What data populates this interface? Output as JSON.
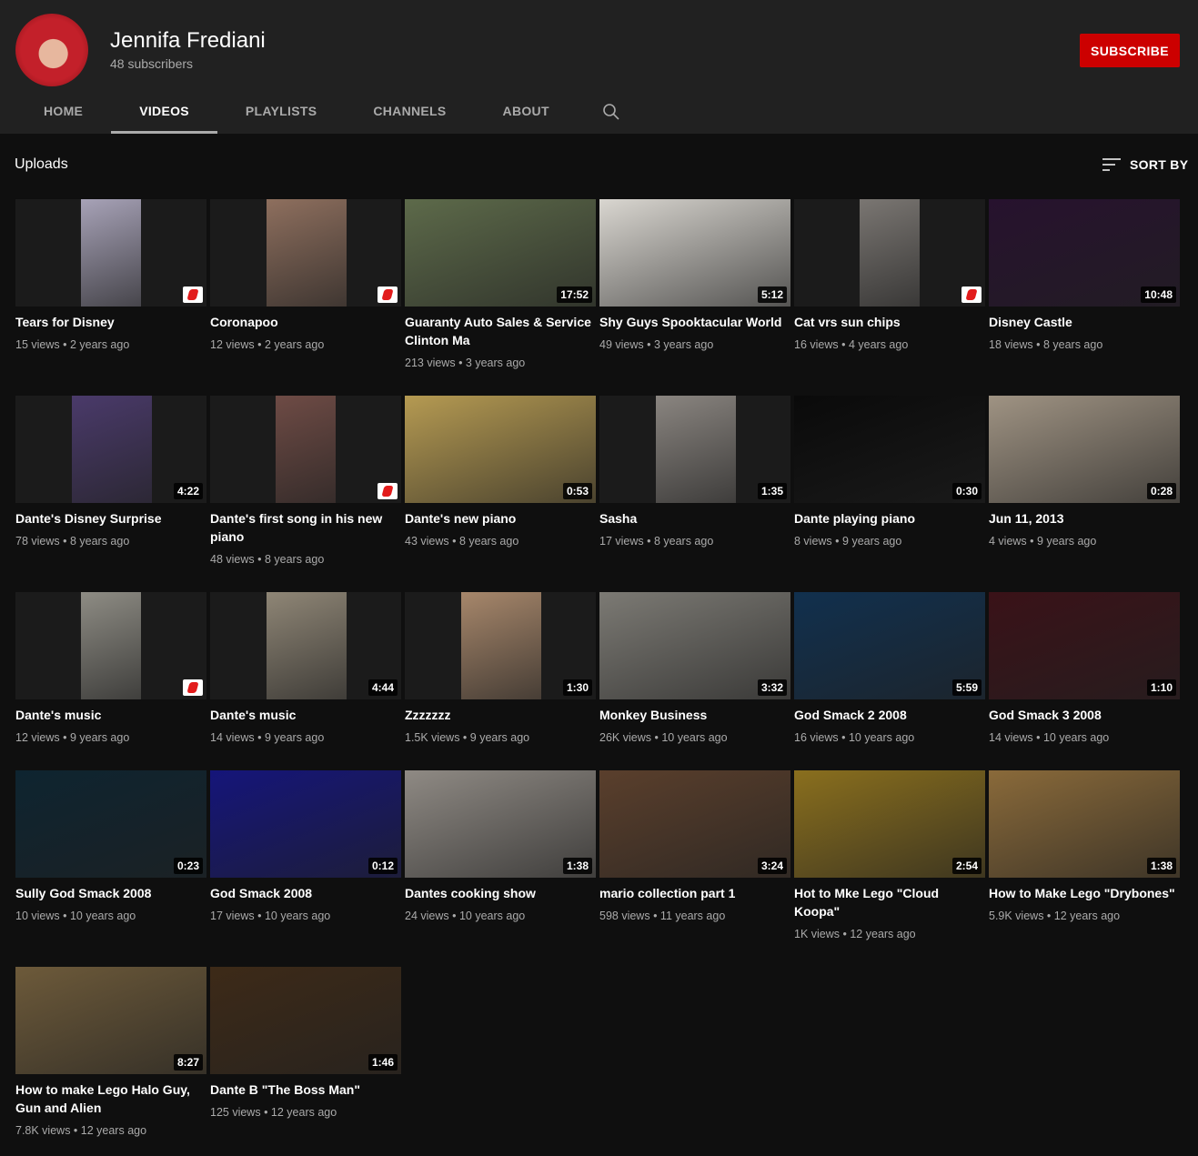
{
  "channel": {
    "name": "Jennifa Frediani",
    "subscribers": "48 subscribers",
    "subscribe_label": "SUBSCRIBE"
  },
  "tabs": [
    {
      "label": "HOME",
      "active": false
    },
    {
      "label": "VIDEOS",
      "active": true
    },
    {
      "label": "PLAYLISTS",
      "active": false
    },
    {
      "label": "CHANNELS",
      "active": false
    },
    {
      "label": "ABOUT",
      "active": false
    }
  ],
  "section": {
    "title": "Uploads",
    "sort_label": "SORT BY"
  },
  "videos": [
    {
      "title": "Tears for Disney",
      "views": "15 views",
      "age": "2 years ago",
      "duration": "",
      "shorts": true,
      "color": "#a7a2b7"
    },
    {
      "title": "Coronapoo",
      "views": "12 views",
      "age": "2 years ago",
      "duration": "",
      "shorts": true,
      "color": "#8e6f5e"
    },
    {
      "title": "Guaranty Auto Sales & Service Clinton Ma",
      "views": "213 views",
      "age": "3 years ago",
      "duration": "17:52",
      "shorts": false,
      "color": "#5d6a4a"
    },
    {
      "title": "Shy Guys Spooktacular World",
      "views": "49 views",
      "age": "3 years ago",
      "duration": "5:12",
      "shorts": false,
      "color": "#d9d6d0"
    },
    {
      "title": "Cat vrs sun chips",
      "views": "16 views",
      "age": "4 years ago",
      "duration": "",
      "shorts": true,
      "color": "#7a7672"
    },
    {
      "title": "Disney Castle",
      "views": "18 views",
      "age": "8 years ago",
      "duration": "10:48",
      "shorts": false,
      "color": "#27122e"
    },
    {
      "title": "Dante's Disney Surprise",
      "views": "78 views",
      "age": "8 years ago",
      "duration": "4:22",
      "shorts": false,
      "color": "#4a3a6a"
    },
    {
      "title": "Dante's first song in his new piano",
      "views": "48 views",
      "age": "8 years ago",
      "duration": "",
      "shorts": true,
      "color": "#6e4b45"
    },
    {
      "title": "Dante's new piano",
      "views": "43 views",
      "age": "8 years ago",
      "duration": "0:53",
      "shorts": false,
      "color": "#b59a52"
    },
    {
      "title": "Sasha",
      "views": "17 views",
      "age": "8 years ago",
      "duration": "1:35",
      "shorts": false,
      "color": "#8a8580"
    },
    {
      "title": "Dante playing piano",
      "views": "8 views",
      "age": "9 years ago",
      "duration": "0:30",
      "shorts": false,
      "color": "#0a0a0a"
    },
    {
      "title": "Jun 11, 2013",
      "views": "4 views",
      "age": "9 years ago",
      "duration": "0:28",
      "shorts": false,
      "color": "#9f9383"
    },
    {
      "title": "Dante's music",
      "views": "12 views",
      "age": "9 years ago",
      "duration": "",
      "shorts": true,
      "color": "#8e8c84"
    },
    {
      "title": "Dante's music",
      "views": "14 views",
      "age": "9 years ago",
      "duration": "4:44",
      "shorts": false,
      "color": "#8f8676"
    },
    {
      "title": "Zzzzzzz",
      "views": "1.5K views",
      "age": "9 years ago",
      "duration": "1:30",
      "shorts": false,
      "color": "#a7876b"
    },
    {
      "title": "Monkey Business",
      "views": "26K views",
      "age": "10 years ago",
      "duration": "3:32",
      "shorts": false,
      "color": "#7c7a74"
    },
    {
      "title": "God Smack 2 2008",
      "views": "16 views",
      "age": "10 years ago",
      "duration": "5:59",
      "shorts": false,
      "color": "#11304e"
    },
    {
      "title": "God Smack 3 2008",
      "views": "14 views",
      "age": "10 years ago",
      "duration": "1:10",
      "shorts": false,
      "color": "#3a1218"
    },
    {
      "title": "Sully God Smack 2008",
      "views": "10 views",
      "age": "10 years ago",
      "duration": "0:23",
      "shorts": false,
      "color": "#0e2430"
    },
    {
      "title": "God Smack 2008",
      "views": "17 views",
      "age": "10 years ago",
      "duration": "0:12",
      "shorts": false,
      "color": "#15157a"
    },
    {
      "title": "Dantes cooking show",
      "views": "24 views",
      "age": "10 years ago",
      "duration": "1:38",
      "shorts": false,
      "color": "#8f8a84"
    },
    {
      "title": "mario collection part 1",
      "views": "598 views",
      "age": "11 years ago",
      "duration": "3:24",
      "shorts": false,
      "color": "#5a3f2c"
    },
    {
      "title": "Hot to Mke Lego \"Cloud Koopa\"",
      "views": "1K views",
      "age": "12 years ago",
      "duration": "2:54",
      "shorts": false,
      "color": "#8a6f1e"
    },
    {
      "title": "How to Make Lego \"Drybones\"",
      "views": "5.9K views",
      "age": "12 years ago",
      "duration": "1:38",
      "shorts": false,
      "color": "#8a6a3a"
    },
    {
      "title": "How to make Lego Halo Guy, Gun and Alien",
      "views": "7.8K views",
      "age": "12 years ago",
      "duration": "8:27",
      "shorts": false,
      "color": "#6d5a3a"
    },
    {
      "title": "Dante B \"The Boss Man\"",
      "views": "125 views",
      "age": "12 years ago",
      "duration": "1:46",
      "shorts": false,
      "color": "#3d2a18"
    }
  ]
}
